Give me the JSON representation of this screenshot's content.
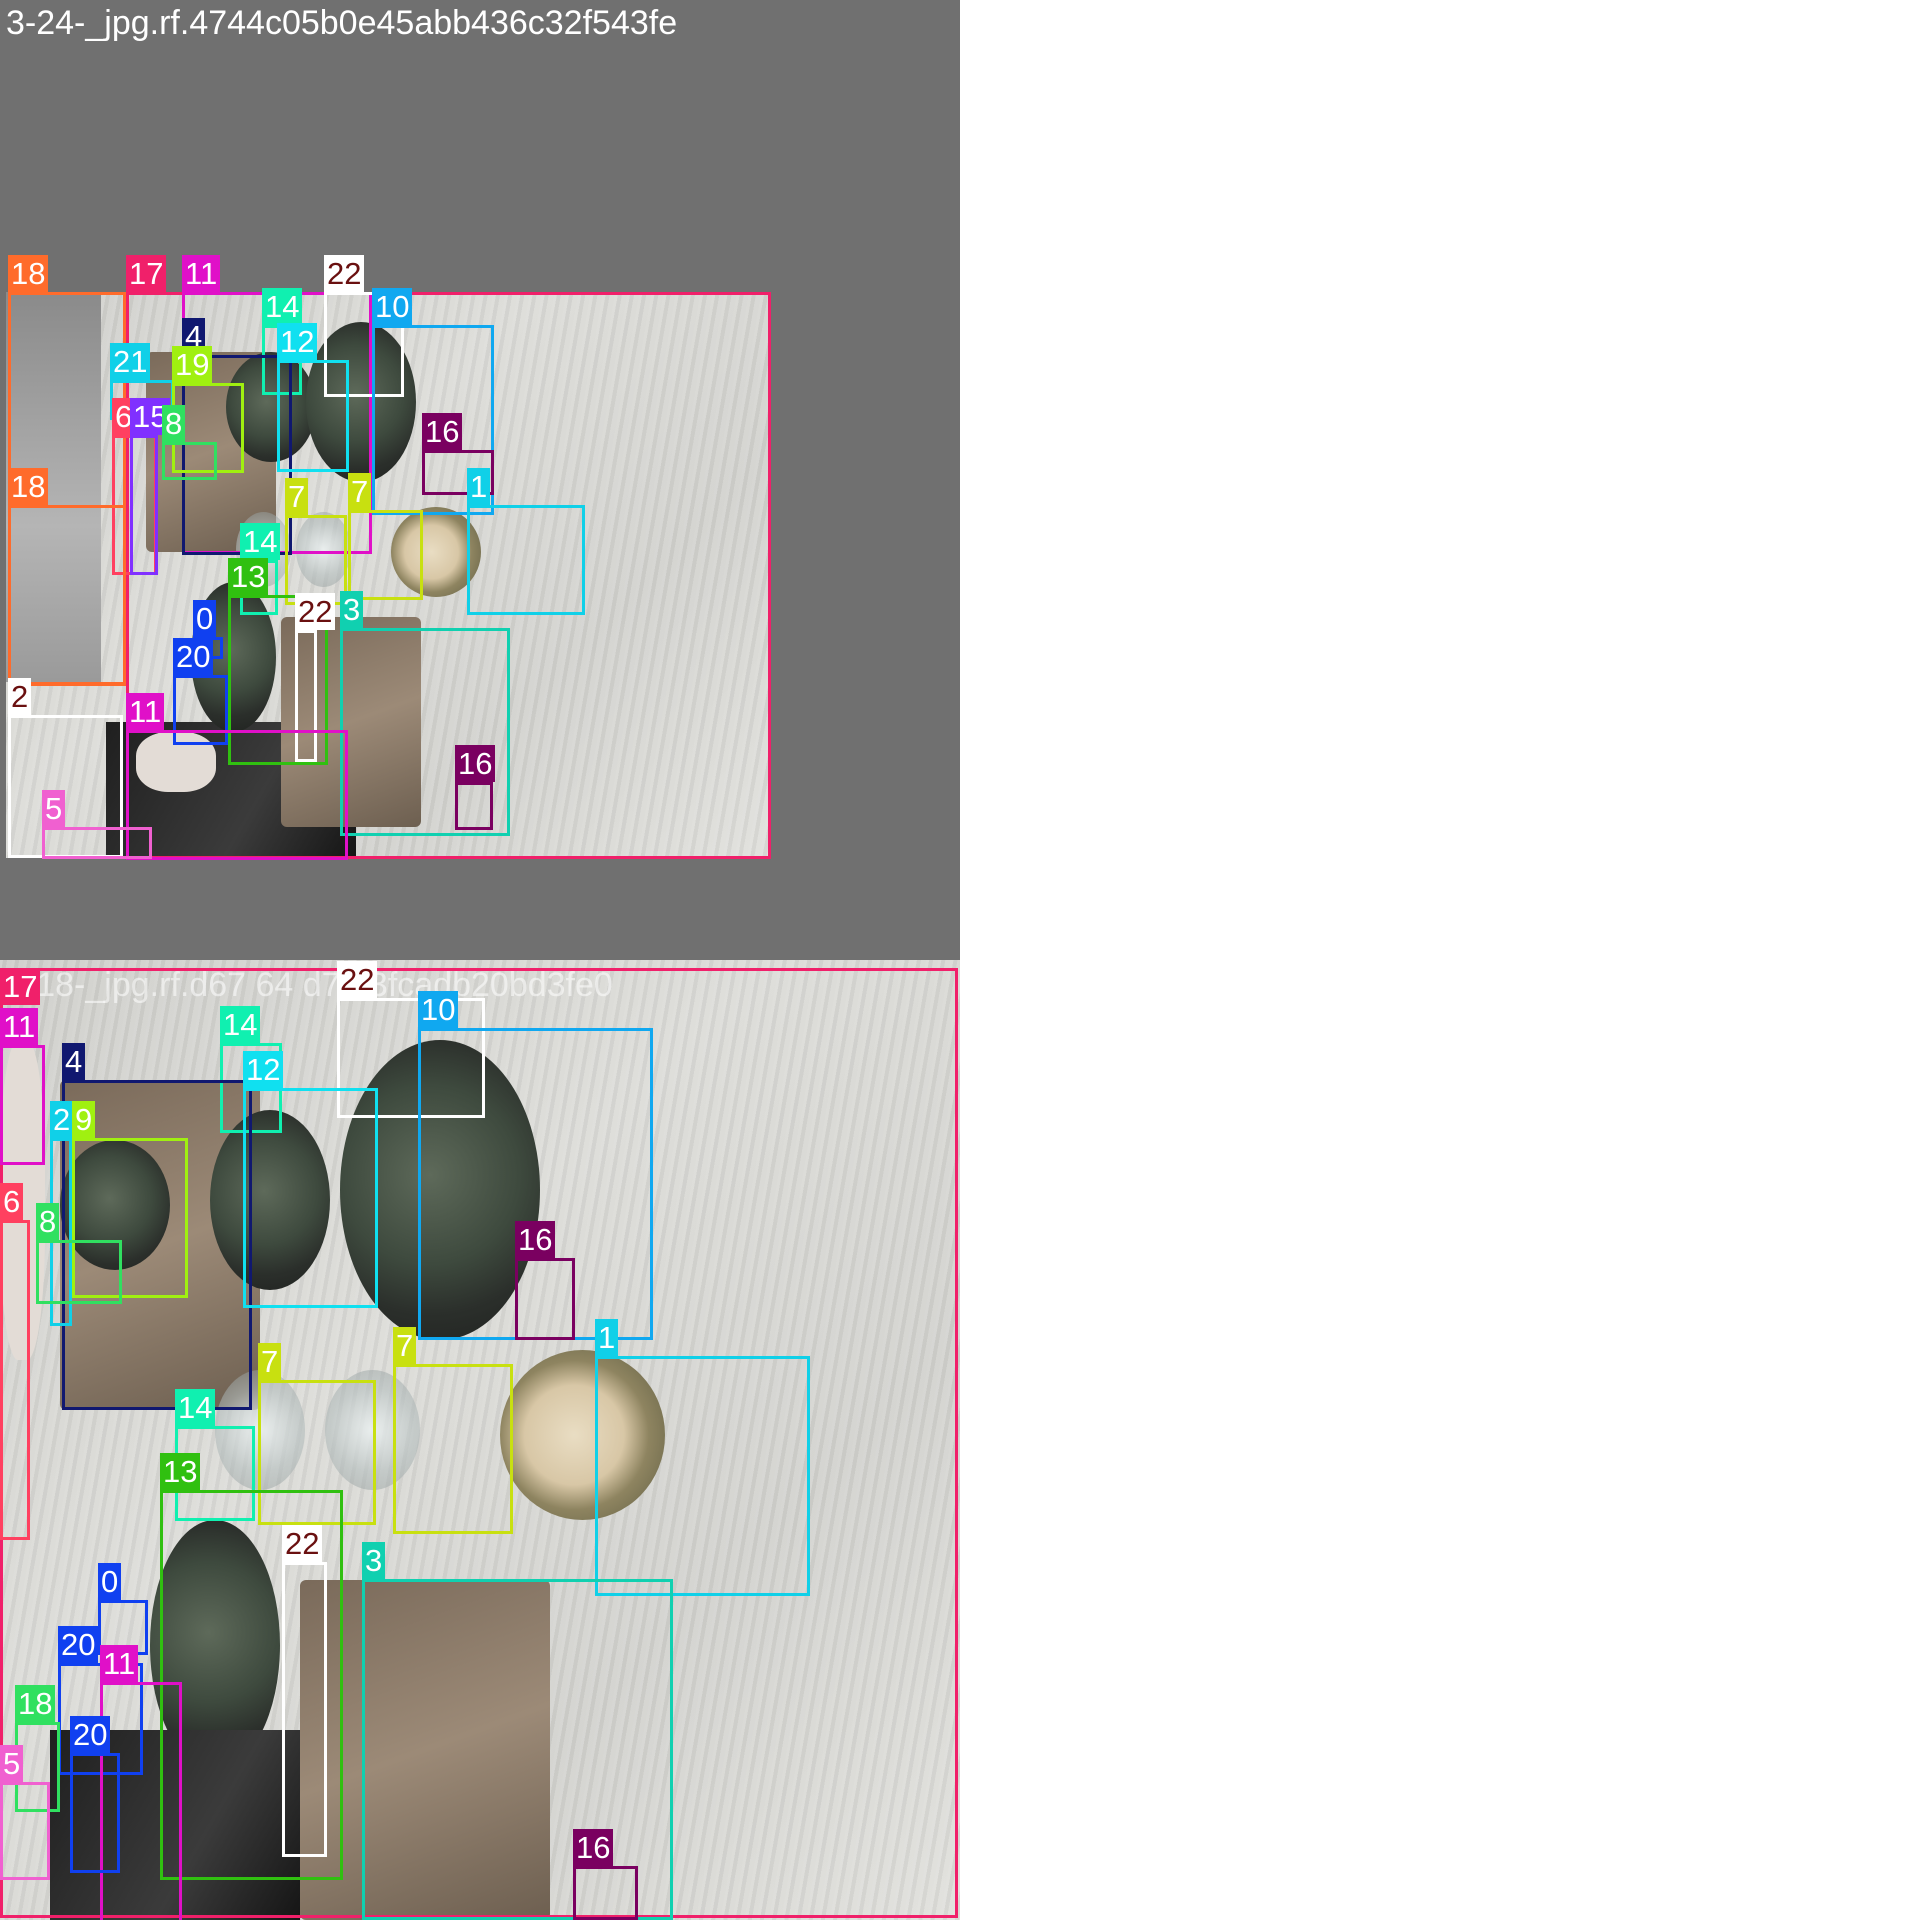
{
  "tiles": [
    {
      "title": "3-24-_jpg.rf.4744c05b0e45abb436c32f543fe",
      "boxes": [
        {
          "label": "18",
          "color": "#ff6b2b"
        },
        {
          "label": "17",
          "color": "#f0206a"
        },
        {
          "label": "11",
          "color": "#e010c8"
        },
        {
          "label": "22",
          "color": "#ffffff",
          "text_color": "#6a1010"
        },
        {
          "label": "10",
          "color": "#10a8f0"
        },
        {
          "label": "14",
          "color": "#10f0b0"
        },
        {
          "label": "4",
          "color": "#101870"
        },
        {
          "label": "12",
          "color": "#10e0f0"
        },
        {
          "label": "21",
          "color": "#10d0e8"
        },
        {
          "label": "19",
          "color": "#a0f010"
        },
        {
          "label": "6",
          "color": "#ff4060"
        },
        {
          "label": "15",
          "color": "#8030ff"
        },
        {
          "label": "8",
          "color": "#30e060"
        },
        {
          "label": "16",
          "color": "#7a0060"
        },
        {
          "label": "18",
          "color": "#ff6b2b"
        },
        {
          "label": "7",
          "color": "#c8e010"
        },
        {
          "label": "7",
          "color": "#c8e010"
        },
        {
          "label": "1",
          "color": "#10d0e8"
        },
        {
          "label": "14",
          "color": "#10f0b0"
        },
        {
          "label": "13",
          "color": "#30c010"
        },
        {
          "label": "22",
          "color": "#ffffff",
          "text_color": "#6a1010"
        },
        {
          "label": "3",
          "color": "#10d0b0"
        },
        {
          "label": "0",
          "color": "#1040f0"
        },
        {
          "label": "20",
          "color": "#1040f0"
        },
        {
          "label": "2",
          "color": "#ffffff",
          "text_color": "#6a1010"
        },
        {
          "label": "11",
          "color": "#e010c8"
        },
        {
          "label": "16",
          "color": "#7a0060"
        },
        {
          "label": "5",
          "color": "#f060d0"
        }
      ]
    },
    {
      "title": "3-18-_jpg.rf.d67 64 d7 63fcadb20bd3fe0",
      "boxes": [
        {
          "label": "17",
          "color": "#f0206a"
        },
        {
          "label": "22",
          "color": "#ffffff",
          "text_color": "#6a1010"
        },
        {
          "label": "10",
          "color": "#10a8f0"
        },
        {
          "label": "14",
          "color": "#10f0b0"
        },
        {
          "label": "11",
          "color": "#e010c8"
        },
        {
          "label": "4",
          "color": "#101870"
        },
        {
          "label": "12",
          "color": "#10e0f0"
        },
        {
          "label": "21",
          "color": "#10d0e8"
        },
        {
          "label": "9",
          "color": "#a0f010"
        },
        {
          "label": "6",
          "color": "#ff4060"
        },
        {
          "label": "8",
          "color": "#30e060"
        },
        {
          "label": "16",
          "color": "#7a0060"
        },
        {
          "label": "7",
          "color": "#c8e010"
        },
        {
          "label": "7",
          "color": "#c8e010"
        },
        {
          "label": "1",
          "color": "#10d0e8"
        },
        {
          "label": "14",
          "color": "#10f0b0"
        },
        {
          "label": "13",
          "color": "#30c010"
        },
        {
          "label": "3",
          "color": "#10d0b0"
        },
        {
          "label": "0",
          "color": "#1040f0"
        },
        {
          "label": "22",
          "color": "#ffffff",
          "text_color": "#6a1010"
        },
        {
          "label": "20",
          "color": "#1040f0"
        },
        {
          "label": "11",
          "color": "#e010c8"
        },
        {
          "label": "18",
          "color": "#30e060"
        },
        {
          "label": "20",
          "color": "#1040f0"
        },
        {
          "label": "5",
          "color": "#f060d0"
        },
        {
          "label": "16",
          "color": "#7a0060"
        }
      ]
    }
  ]
}
